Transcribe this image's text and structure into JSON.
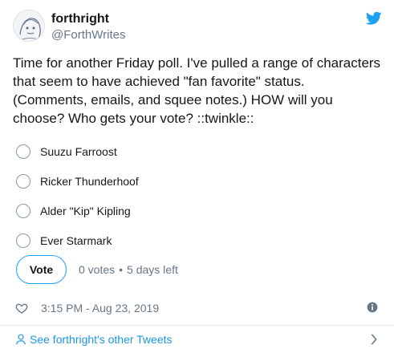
{
  "header": {
    "display_name": "forthright",
    "handle": "@ForthWrites",
    "avatar_icon": "avatar-sketch",
    "brand_icon": "twitter-bird-icon",
    "brand_color": "#1da1f2"
  },
  "tweet": {
    "text": "Time for another Friday poll. I've pulled a range of characters that seem to have achieved \"fan favorite\" status. (Comments, emails, and squee notes.) HOW will you choose? Who gets your vote? ::twinkle::"
  },
  "poll": {
    "options": [
      {
        "label": "Suuzu Farroost"
      },
      {
        "label": "Ricker Thunderhoof"
      },
      {
        "label": "Alder \"Kip\" Kipling"
      },
      {
        "label": "Ever Starmark"
      }
    ],
    "vote_button_label": "Vote",
    "votes_text": "0 votes",
    "separator": "•",
    "time_left": "5 days left"
  },
  "meta": {
    "like_icon": "heart-icon",
    "timestamp": "3:15 PM - Aug 23, 2019",
    "info_icon": "info-icon"
  },
  "footer": {
    "link_text": "See forthright's other Tweets",
    "link_color": "#1b95e0",
    "chevron_icon": "chevron-right-icon",
    "person_icon": "person-icon"
  }
}
